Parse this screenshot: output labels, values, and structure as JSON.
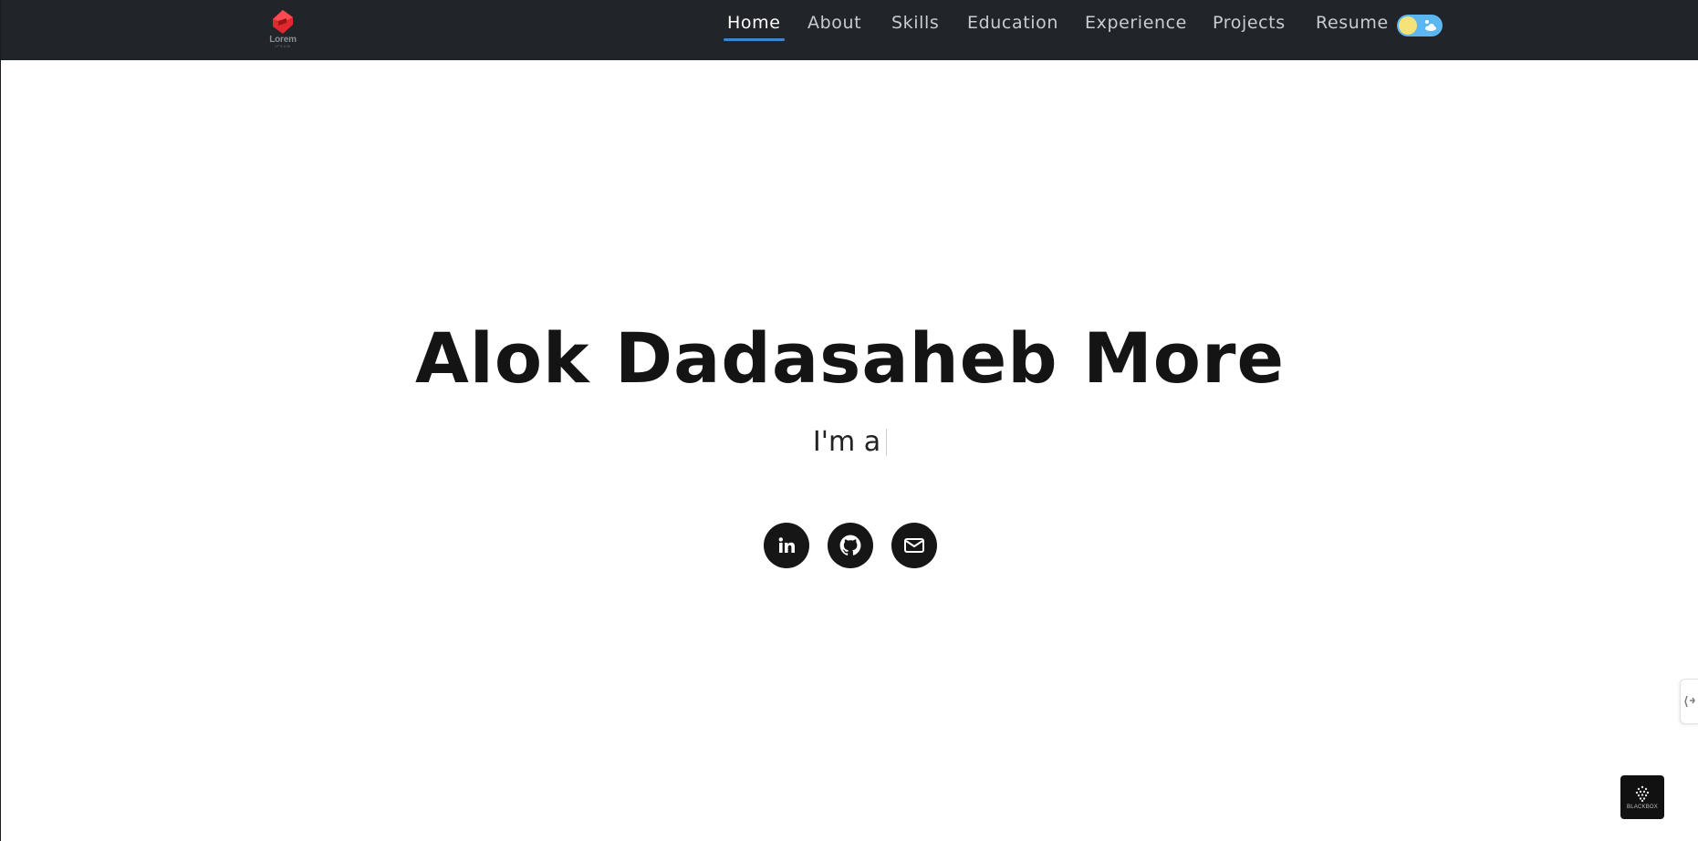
{
  "nav": {
    "logo_text": "Lorem",
    "logo_sub": "IPSUM",
    "links": [
      {
        "label": "Home",
        "active": true
      },
      {
        "label": "About",
        "active": false
      },
      {
        "label": "Skills",
        "active": false
      },
      {
        "label": "Education",
        "active": false
      },
      {
        "label": "Experience",
        "active": false
      },
      {
        "label": "Projects",
        "active": false
      },
      {
        "label": "Resume",
        "active": false
      }
    ],
    "theme_toggle": {
      "state": "light",
      "sun_color": "#f5e37a",
      "track_color": "#5cb6f0"
    }
  },
  "hero": {
    "name": "Alok Dadasaheb More",
    "tagline": "I'm a",
    "socials": [
      {
        "icon": "linkedin-icon"
      },
      {
        "icon": "github-icon"
      },
      {
        "icon": "mail-icon"
      }
    ]
  },
  "badge": {
    "text": "BLACKBOX"
  },
  "colors": {
    "nav_bg": "#212529",
    "accent": "#3a86d4",
    "text_dark": "#141414",
    "logo_red": "#e0282e"
  }
}
